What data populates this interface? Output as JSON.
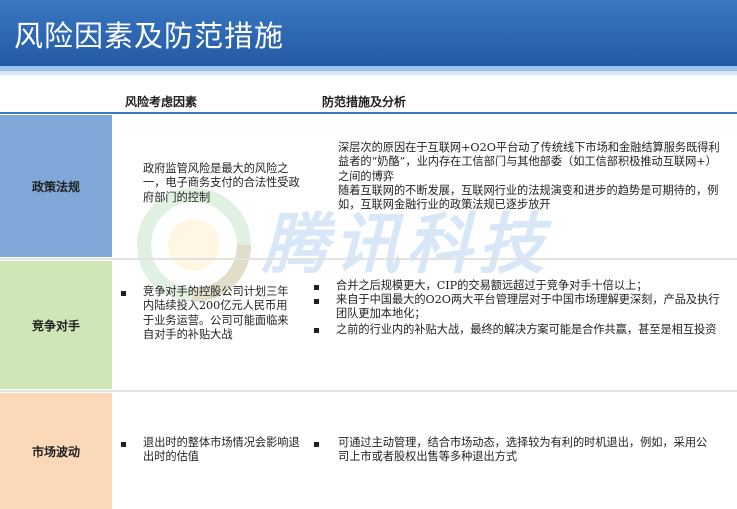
{
  "title": "风险因素及防范措施",
  "headers": {
    "factor": "风险考虑因素",
    "measure": "防范措施及分析"
  },
  "watermark": "腾讯科技",
  "rows": [
    {
      "label": "政策法规",
      "factor": "政府监管风险是最大的风险之一，电子商务支付的合法性受政府部门的控制",
      "measure": "深层次的原因在于互联网+O2O平台动了传统线下市场和金融结算服务既得利益者的“奶酪”，业内存在工信部门与其他部委（如工信部积极推动互联网+）之间的博弈\n随着互联网的不断发展，互联网行业的法规演变和进步的趋势是可期待的，例如，互联网金融行业的政策法规已逐步放开"
    },
    {
      "label": "竞争对手",
      "factor": "竞争对手的控股公司计划三年内陆续投入200亿元人民币用于业务运营。公司可能面临来自对手的补贴大战",
      "measures": [
        "合并之后规模更大，CIP的交易额远超过于竞争对手十倍以上；",
        "来自于中国最大的O2O两大平台管理层对于中国市场理解更深刻，产品及执行团队更加本地化；",
        "之前的行业内的补贴大战，最终的解决方案可能是合作共赢，甚至是相互投资"
      ]
    },
    {
      "label": "市场波动",
      "factor": "退出时的整体市场情况会影响退出时的估值",
      "measure": "可通过主动管理，结合市场动态，选择较为有利的时机退出，例如，采用公司上市或者股权出售等多种退出方式"
    }
  ]
}
